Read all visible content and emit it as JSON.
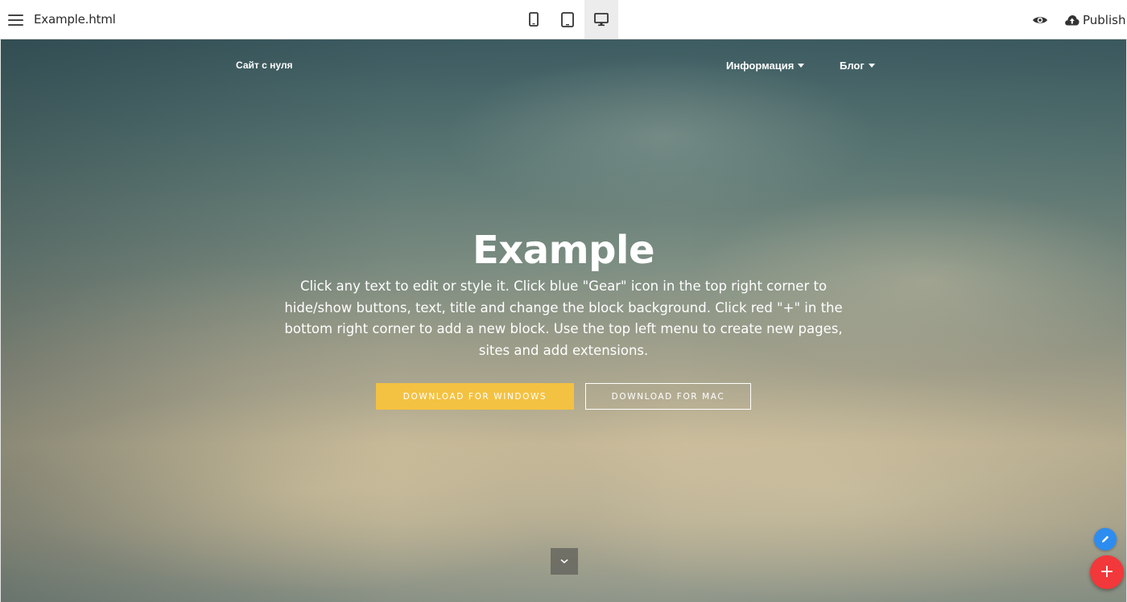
{
  "editor": {
    "filename": "Example.html",
    "devices": [
      {
        "name": "phone",
        "icon": "phone-icon",
        "active": false
      },
      {
        "name": "tablet",
        "icon": "tablet-icon",
        "active": false
      },
      {
        "name": "desktop",
        "icon": "desktop-icon",
        "active": true
      }
    ],
    "publish_label": "Publish",
    "icons": {
      "menu": "hamburger-menu-icon",
      "preview": "eye-icon",
      "publish": "cloud-upload-icon"
    }
  },
  "site": {
    "nav": {
      "brand": "Сайт с нуля",
      "items": [
        {
          "label": "Информация"
        },
        {
          "label": "Блог"
        }
      ]
    },
    "hero": {
      "title": "Example",
      "text": "Click any text to edit or style it. Click blue \"Gear\" icon in the top right corner to hide/show buttons, text, title and change the block background. Click red \"+\" in the bottom right corner to add a new block. Use the top left menu to create new pages, sites and add extensions.",
      "buttons": [
        {
          "label": "DOWNLOAD FOR WINDOWS"
        },
        {
          "label": "DOWNLOAD FOR MAC"
        }
      ]
    }
  },
  "fabs": {
    "edit_icon": "pencil-icon",
    "add_label": "+"
  },
  "colors": {
    "primary_button": "#f4c242",
    "fab_edit": "#2d8cf0",
    "fab_add": "#f2383a"
  }
}
